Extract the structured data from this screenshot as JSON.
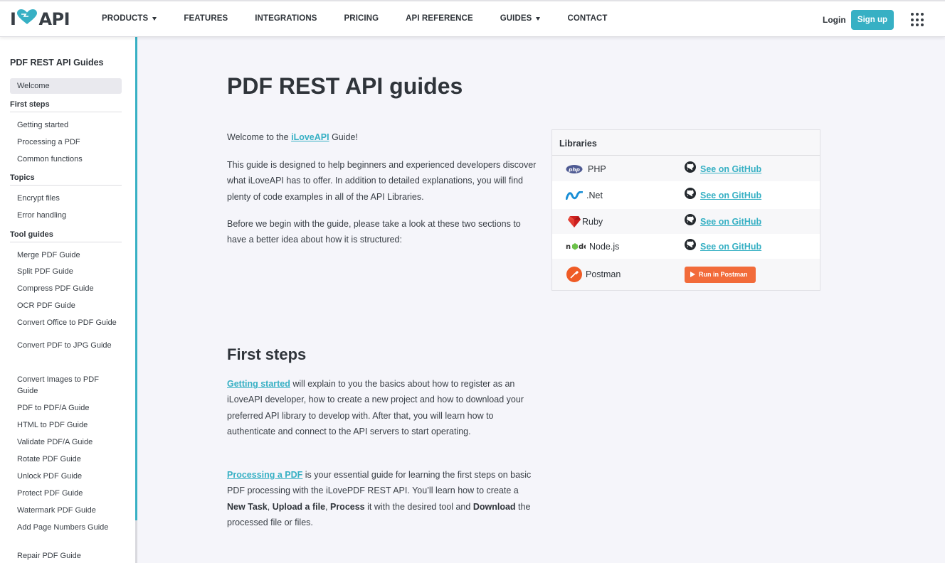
{
  "header": {
    "logo": {
      "left": "I",
      "right": "API"
    },
    "nav": [
      {
        "label": "PRODUCTS",
        "dropdown": true
      },
      {
        "label": "FEATURES",
        "dropdown": false
      },
      {
        "label": "INTEGRATIONS",
        "dropdown": false
      },
      {
        "label": "PRICING",
        "dropdown": false
      },
      {
        "label": "API REFERENCE",
        "dropdown": false
      },
      {
        "label": "GUIDES",
        "dropdown": true
      },
      {
        "label": "CONTACT",
        "dropdown": false
      }
    ],
    "login": "Login",
    "signup": "Sign up",
    "apps_icon": "grid-apps-icon"
  },
  "sidebar": {
    "title": "PDF REST API Guides",
    "welcome": "Welcome",
    "sections": [
      {
        "title": "First steps",
        "items": [
          "Getting started",
          "Processing a PDF",
          "Common functions"
        ]
      },
      {
        "title": "Topics",
        "items": [
          "Encrypt files",
          "Error handling"
        ]
      },
      {
        "title": "Tool guides",
        "items": [
          "Merge PDF Guide",
          "Split PDF Guide",
          "Compress PDF Guide",
          "OCR PDF Guide",
          "Convert Office to PDF Guide",
          "Convert PDF to JPG Guide",
          "Convert Images to PDF Guide",
          "PDF to PDF/A Guide",
          "HTML to PDF Guide",
          "Validate PDF/A Guide",
          "Rotate PDF Guide",
          "Unlock PDF Guide",
          "Protect PDF Guide",
          "Watermark PDF Guide",
          "Add Page Numbers Guide",
          "Repair PDF Guide"
        ]
      }
    ]
  },
  "main": {
    "title": "PDF REST API guides",
    "intro": {
      "before": "Welcome to the ",
      "link": "iLoveAPI",
      "after": " Guide!"
    },
    "p1": "This guide is designed to help beginners and experienced developers discover what iLoveAPI has to offer. In addition to detailed explanations, you will find plenty of code examples in all of the API Libraries.",
    "p2": "Before we begin with the guide, please take a look at these two sections to have a better idea about how it is structured:",
    "first_steps_title": "First steps",
    "fs1": {
      "link": "Getting started",
      "text": " will explain to you the basics about how to register as an iLoveAPI developer, how to create a new project and how to download your preferred API library to develop with. After that, you will learn how to authenticate and connect to the API servers to start operating."
    },
    "fs2": {
      "link": "Processing a PDF",
      "t1": " is your essential guide for learning the first steps on basic PDF processing with the iLovePDF REST API. You’ll learn how to create a ",
      "b1": "New Task",
      "t2": ", ",
      "b2": "Upload a file",
      "t3": ", ",
      "b3": "Process",
      "t4": " it with the desired tool and ",
      "b4": "Download",
      "t5": " the processed file or files."
    }
  },
  "libraries": {
    "title": "Libraries",
    "rows": [
      {
        "name": "PHP",
        "icon": "php-icon",
        "action": "See on GitHub"
      },
      {
        "name": ".Net",
        "icon": "dotnet-icon",
        "action": "See on GitHub"
      },
      {
        "name": "Ruby",
        "icon": "ruby-icon",
        "action": "See on GitHub"
      },
      {
        "name": "Node.js",
        "icon": "nodejs-icon",
        "action": "See on GitHub"
      },
      {
        "name": "Postman",
        "icon": "postman-icon",
        "action": "Run in Postman"
      }
    ]
  },
  "colors": {
    "accent": "#37b0c4",
    "postman": "#f26b3a",
    "text": "#383e45"
  }
}
